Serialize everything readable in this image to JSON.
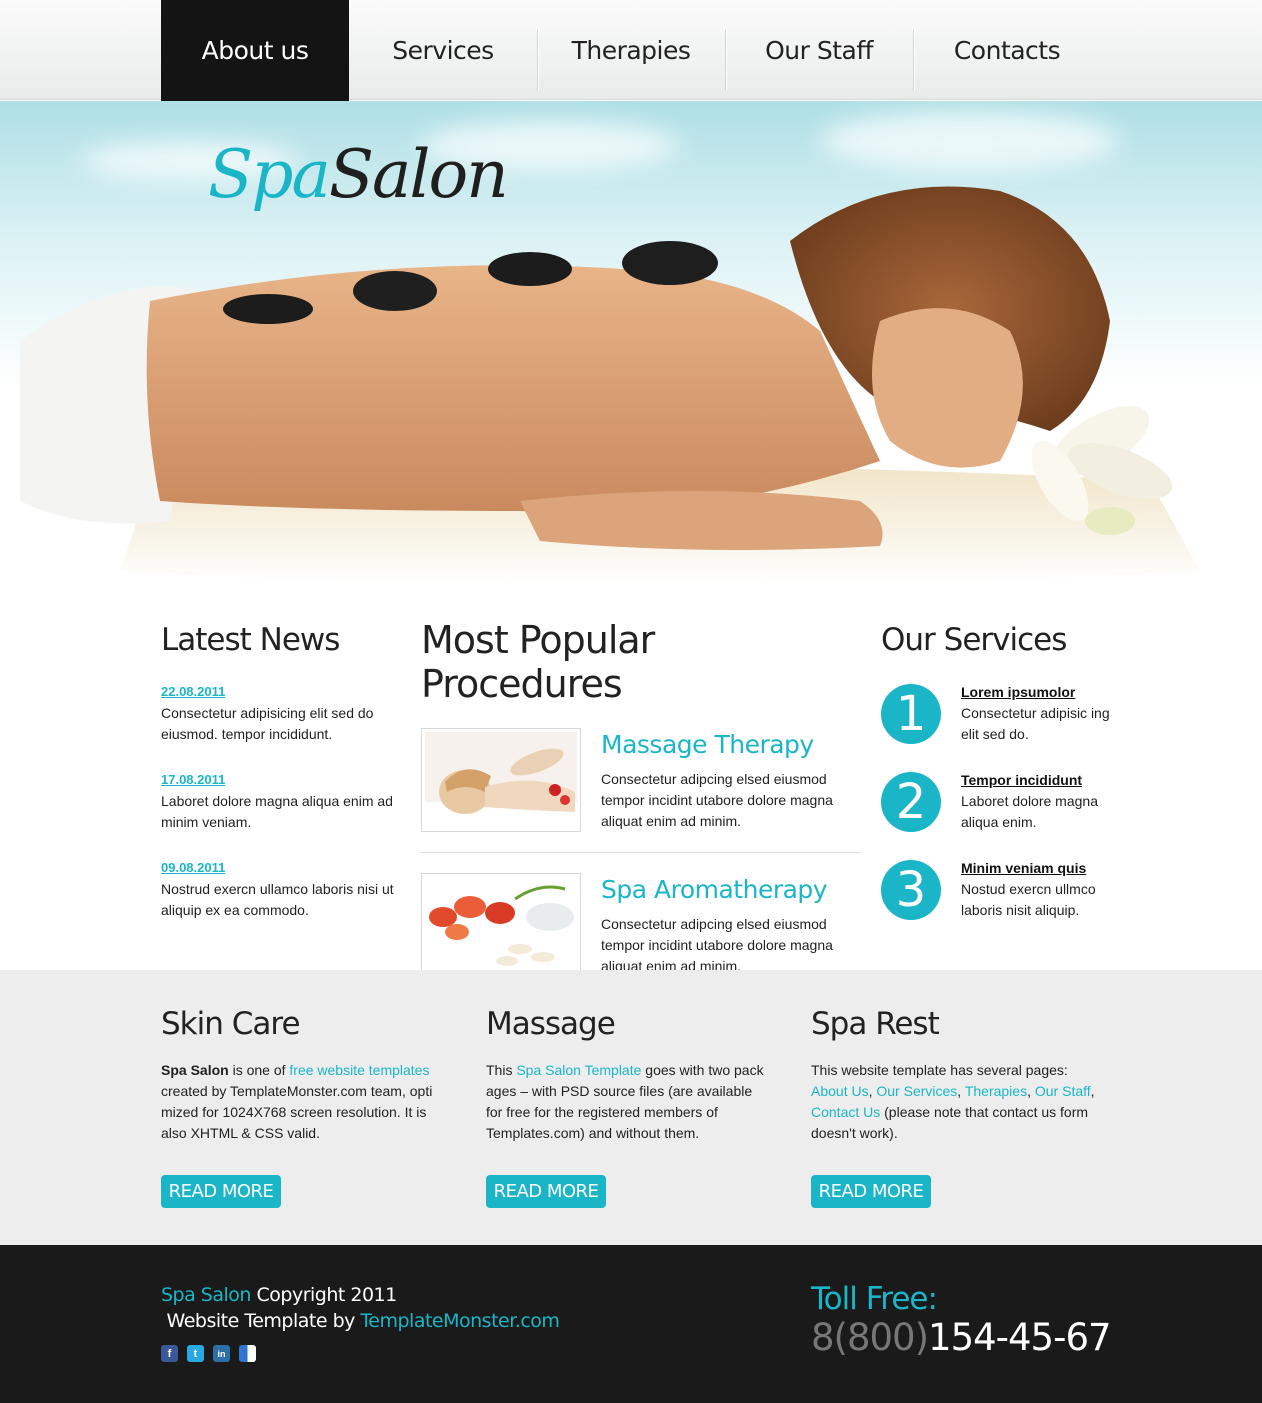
{
  "nav": {
    "items": [
      {
        "label": "About us",
        "active": true
      },
      {
        "label": "Services"
      },
      {
        "label": "Therapies"
      },
      {
        "label": "Our Staff"
      },
      {
        "label": "Contacts"
      }
    ]
  },
  "hero": {
    "logo_spa": "Spa",
    "logo_salon": "Salon"
  },
  "news": {
    "title": "Latest News",
    "items": [
      {
        "date": "22.08.2011",
        "text": "Consectetur adipisicing elit sed do eiusmod. tempor incididunt."
      },
      {
        "date": "17.08.2011",
        "text": "Laboret dolore magna aliqua enim ad minim veniam."
      },
      {
        "date": "09.08.2011",
        "text": "Nostrud exercn ullamco laboris nisi ut aliquip ex ea commodo."
      }
    ]
  },
  "procedures": {
    "title": "Most Popular Procedures",
    "items": [
      {
        "title": "Massage Therapy",
        "text": "Consectetur adipcing elsed eiusmod tempor incidint utabore dolore magna aliquat enim ad minim."
      },
      {
        "title": "Spa Aromatherapy",
        "text": "Consectetur adipcing elsed eiusmod tempor incidint utabore dolore magna aliquat enim ad minim."
      }
    ]
  },
  "services": {
    "title": "Our Services",
    "items": [
      {
        "num": "1",
        "title": "Lorem ipsumolor",
        "text": "Consectetur adipisic ing elit sed do."
      },
      {
        "num": "2",
        "title": "Tempor incididunt",
        "text": "Laboret dolore magna aliqua enim."
      },
      {
        "num": "3",
        "title": "Minim veniam quis",
        "text": "Nostud exercn ullmco laboris nisit aliquip."
      }
    ]
  },
  "columns": {
    "skin": {
      "title": "Skin Care",
      "bold": "Spa Salon",
      "t1": " is one of ",
      "link1": "free website templates",
      "t2": " created by TemplateMonster.com team, opti mized for 1024X768 screen resolution. It is also XHTML & CSS valid."
    },
    "massage": {
      "title": "Massage",
      "t1": "This ",
      "link1": "Spa Salon Template",
      "t2": " goes with two pack ages – with PSD source files (are available for free for the registered members of Templates.com) and without them."
    },
    "rest": {
      "title": "Spa Rest",
      "t1": "This website template has several pages: ",
      "links": [
        "About Us",
        "Our Services",
        "Therapies",
        "Our Staff",
        "Contact Us"
      ],
      "t2": " (please note that contact us form doesn't work)."
    },
    "read_more": "READ MORE"
  },
  "footer": {
    "brand": "Spa Salon",
    "copyright": " Copyright 2011",
    "by": "Website Template by ",
    "tm": "TemplateMonster.com",
    "toll_label": "Toll Free:",
    "toll_prefix": "8(800)",
    "toll_number": "154-45-67",
    "social": [
      {
        "icon": "facebook-icon",
        "glyph": "f",
        "color": "#3b5998"
      },
      {
        "icon": "twitter-icon",
        "glyph": "t",
        "color": "#29a9e1"
      },
      {
        "icon": "linkedin-icon",
        "glyph": "in",
        "color": "#2b6ea8"
      },
      {
        "icon": "delicious-icon",
        "glyph": "",
        "color": "#3274d1"
      }
    ]
  },
  "colors": {
    "accent": "#1ab6c8",
    "dark": "#141414",
    "band": "#ededed"
  }
}
